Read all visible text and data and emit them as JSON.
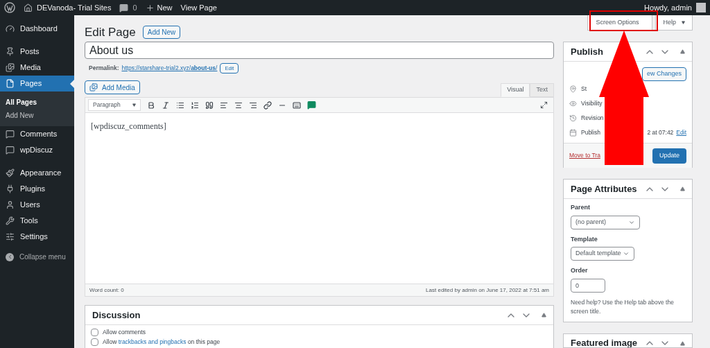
{
  "admin_bar": {
    "site": "DEVanoda- Trial Sites",
    "comments": "0",
    "new": "New",
    "view": "View Page",
    "howdy": "Howdy, admin"
  },
  "sidebar": {
    "groups": [
      [
        {
          "label": "Dashboard",
          "selected": false
        }
      ],
      [
        {
          "label": "Posts",
          "selected": false
        },
        {
          "label": "Media",
          "selected": false
        },
        {
          "label": "Pages",
          "selected": true,
          "children": [
            {
              "label": "All Pages",
              "selected": true
            },
            {
              "label": "Add New",
              "selected": false
            }
          ]
        },
        {
          "label": "Comments",
          "selected": false
        },
        {
          "label": "wpDiscuz",
          "selected": false
        }
      ],
      [
        {
          "label": "Appearance",
          "selected": false
        },
        {
          "label": "Plugins",
          "selected": false
        },
        {
          "label": "Users",
          "selected": false
        },
        {
          "label": "Tools",
          "selected": false
        },
        {
          "label": "Settings",
          "selected": false
        }
      ]
    ],
    "collapse": "Collapse menu"
  },
  "header": {
    "title": "Edit Page",
    "add_new": "Add New",
    "screen_options": "Screen Options",
    "help": "Help"
  },
  "editor": {
    "title_value": "About us",
    "permalink_label": "Permalink:",
    "permalink_base": "https://starshare-trial2.xyz/",
    "permalink_slug": "about-us",
    "permalink_end": "/",
    "permalink_edit": "Edit",
    "add_media": "Add Media",
    "tabs": [
      {
        "label": "Visual",
        "selected": true
      },
      {
        "label": "Text",
        "selected": false
      }
    ],
    "format": "Paragraph",
    "content": "[wpdiscuz_comments]",
    "word_count": "Word count: 0",
    "last_edited": "Last edited by admin on June 17, 2022 at 7:51 am"
  },
  "discussion": {
    "title": "Discussion",
    "options": [
      {
        "label": "Allow comments",
        "checked": false
      },
      {
        "label": "Allow **trackbacks and pingbacks** on this page",
        "checked": false
      }
    ]
  },
  "publish": {
    "title": "Publish",
    "preview": "ew Changes",
    "status": "St",
    "visibility": "Visibility",
    "revisions": "Revision",
    "published": "Publish",
    "published_tail": "2 at 07:42",
    "edit": "Edit",
    "trash": "Move to Tra",
    "update": "Update"
  },
  "page_attributes": {
    "title": "Page Attributes",
    "parent_label": "Parent",
    "parent_value": "(no parent)",
    "template_label": "Template",
    "template_value": "Default template",
    "order_label": "Order",
    "order_value": "0",
    "help": "Need help? Use the Help tab above the screen title."
  },
  "featured_image": {
    "title": "Featured image"
  }
}
